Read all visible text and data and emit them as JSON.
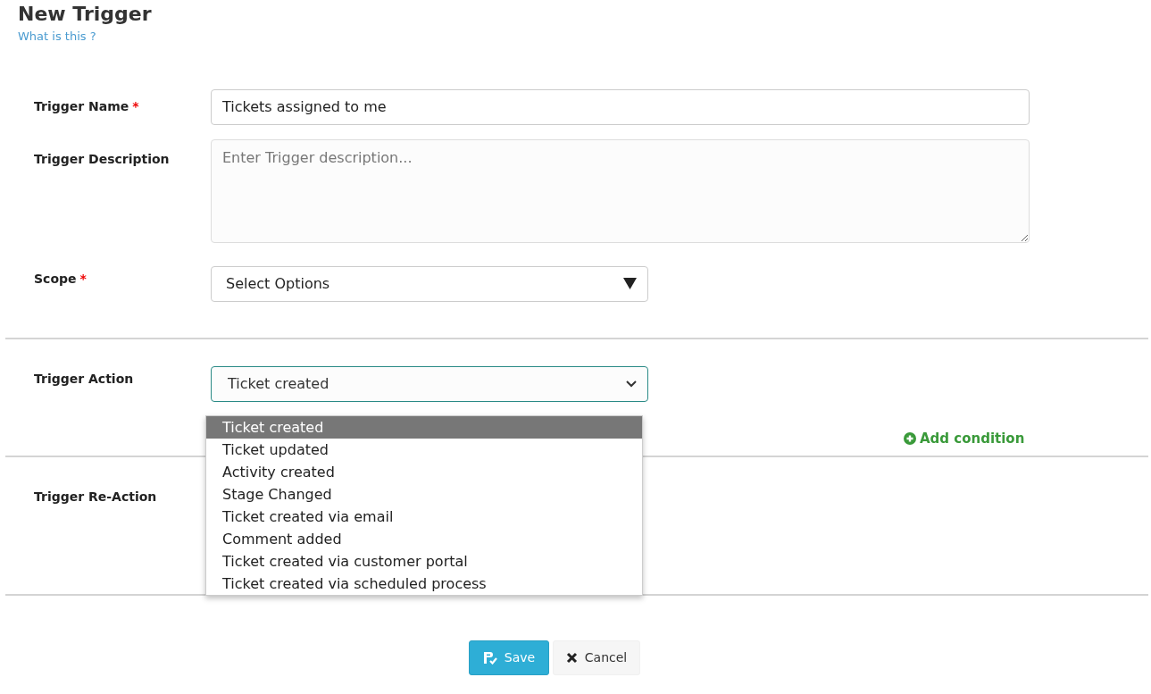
{
  "title": "New Trigger",
  "help_link": "What is this ?",
  "name_field": {
    "label": "Trigger Name",
    "required_mark": "*",
    "value": "Tickets assigned to me"
  },
  "description_field": {
    "label": "Trigger Description",
    "placeholder": "Enter Trigger description..."
  },
  "scope_field": {
    "label": "Scope",
    "required_mark": "*",
    "value": "Select Options"
  },
  "action_field": {
    "label": "Trigger Action",
    "value": "Ticket created",
    "expanded": true,
    "options": [
      {
        "label": "Ticket created",
        "selected": true
      },
      {
        "label": "Ticket updated",
        "selected": false
      },
      {
        "label": "Activity created",
        "selected": false
      },
      {
        "label": "Stage Changed",
        "selected": false
      },
      {
        "label": "Ticket created via email",
        "selected": false
      },
      {
        "label": "Comment added",
        "selected": false
      },
      {
        "label": "Ticket created via customer portal",
        "selected": false
      },
      {
        "label": "Ticket created via scheduled process",
        "selected": false
      }
    ]
  },
  "add_condition": "Add condition",
  "reaction_label": "Trigger Re-Action",
  "buttons": [
    {
      "kind": "save",
      "label": "Save"
    },
    {
      "kind": "cancel",
      "label": "Cancel"
    }
  ]
}
